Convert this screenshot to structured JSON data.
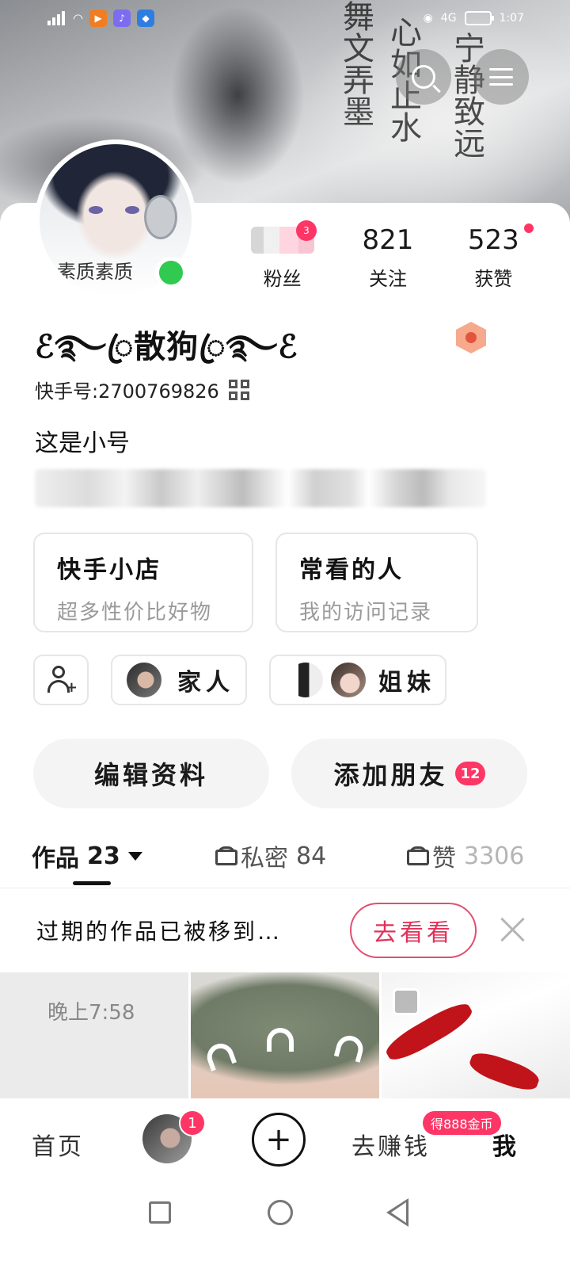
{
  "status_bar": {
    "time": "1:07",
    "network": "4G",
    "battery": "78"
  },
  "header": {
    "calligraphy_1": "舞文弄墨",
    "calligraphy_2": "心如止水",
    "calligraphy_3": "宁静致远"
  },
  "profile": {
    "avatar_caption": "素质素质",
    "nickname": "ℰ࿐ꦿ散狗ꦿ࿐ℰ",
    "uid_label": "快手号:",
    "uid_value": "2700769826",
    "bio": "这是小号"
  },
  "stats": [
    {
      "value": "",
      "label": "粉丝",
      "badge": "3"
    },
    {
      "value": "821",
      "label": "关注"
    },
    {
      "value": "523",
      "label": "获赞"
    }
  ],
  "entries": [
    {
      "title": "快手小店",
      "subtitle": "超多性价比好物"
    },
    {
      "title": "常看的人",
      "subtitle": "我的访问记录"
    }
  ],
  "chips": {
    "family_label": "家人",
    "sisters_label": "姐妹"
  },
  "actions": {
    "edit_profile": "编辑资料",
    "add_friend": "添加朋友",
    "add_friend_badge": "12"
  },
  "tabs": [
    {
      "label": "作品",
      "count": "23"
    },
    {
      "label": "私密",
      "count": "84"
    },
    {
      "label": "赞",
      "count": "3306"
    }
  ],
  "notice": {
    "text": "过期的作品已被移到…",
    "button": "去看看"
  },
  "thumbnails": {
    "first_caption": "晚上7:58"
  },
  "bottom_nav": {
    "home": "首页",
    "avatar_badge": "1",
    "create_symbol": "+",
    "earn": "去赚钱",
    "earn_badge": "得888金币",
    "me": "我"
  },
  "colors": {
    "accent_red": "#fe3666",
    "online_green": "#2fca4f",
    "notice_button": "#e0325a"
  }
}
